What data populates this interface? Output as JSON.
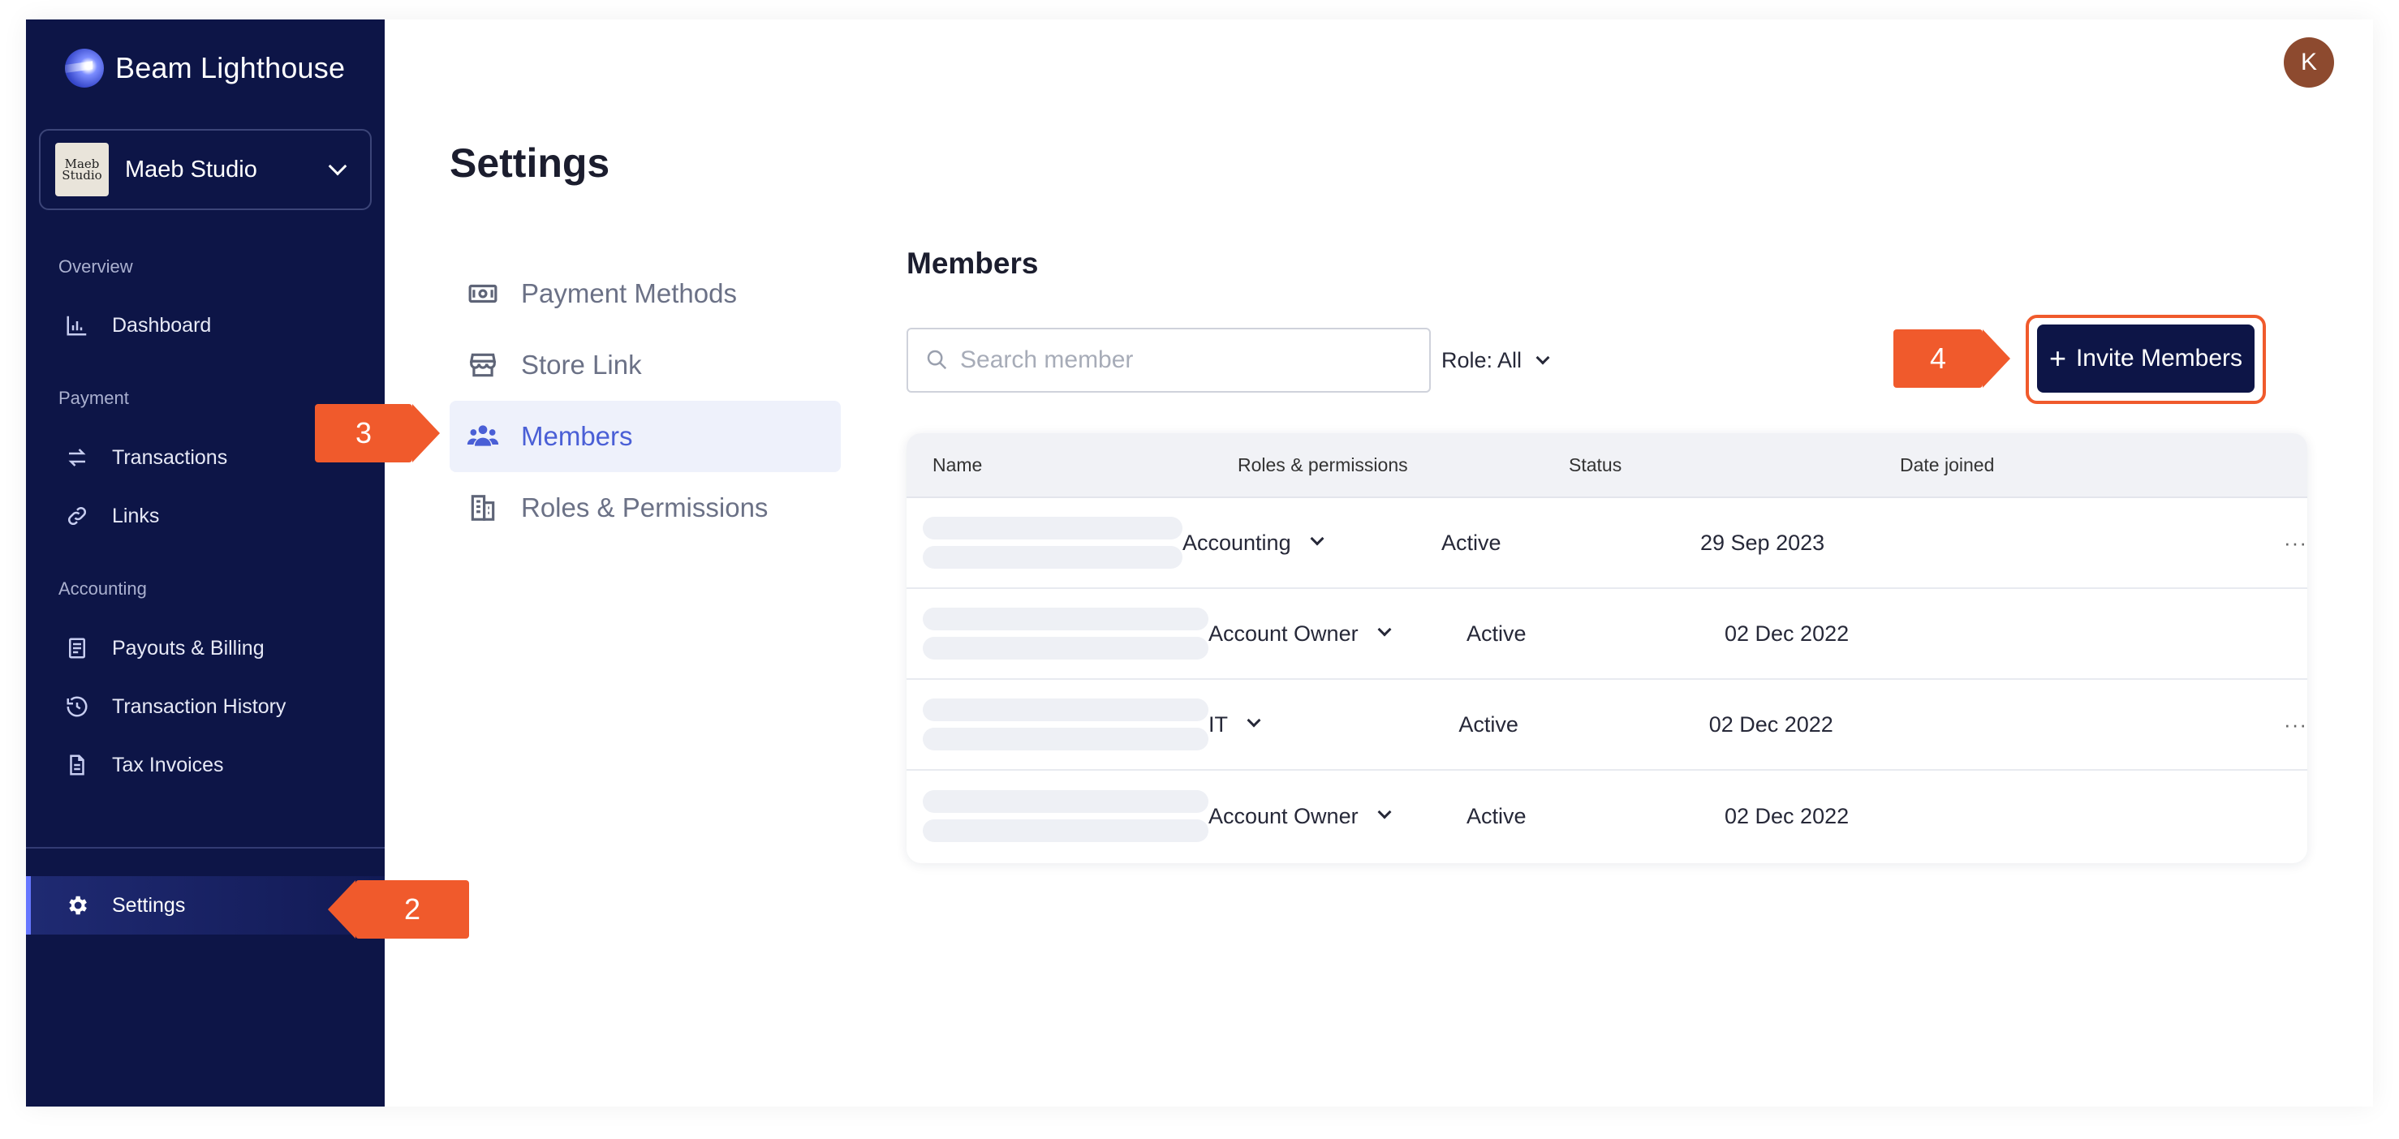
{
  "app": {
    "name": "Beam Lighthouse",
    "user_initial": "K"
  },
  "store": {
    "name": "Maeb Studio",
    "avatar_text": "Maeb Studio"
  },
  "sidebar": {
    "sections": [
      {
        "label": "Overview",
        "items": [
          {
            "label": "Dashboard",
            "icon": "bar-chart-icon"
          }
        ]
      },
      {
        "label": "Payment",
        "items": [
          {
            "label": "Transactions",
            "icon": "arrows-swap-icon"
          },
          {
            "label": "Links",
            "icon": "link-icon"
          }
        ]
      },
      {
        "label": "Accounting",
        "items": [
          {
            "label": "Payouts & Billing",
            "icon": "receipt-icon"
          },
          {
            "label": "Transaction History",
            "icon": "history-icon"
          },
          {
            "label": "Tax Invoices",
            "icon": "document-icon"
          }
        ]
      }
    ],
    "settings": {
      "label": "Settings",
      "icon": "gear-icon"
    }
  },
  "page": {
    "title": "Settings"
  },
  "settings_nav": [
    {
      "label": "Payment Methods",
      "icon": "cash-icon"
    },
    {
      "label": "Store Link",
      "icon": "store-icon"
    },
    {
      "label": "Members",
      "icon": "users-icon",
      "active": true
    },
    {
      "label": "Roles & Permissions",
      "icon": "building-icon"
    }
  ],
  "members": {
    "title": "Members",
    "search_placeholder": "Search member",
    "role_filter": "Role: All",
    "invite_label": "Invite Members",
    "columns": [
      "Name",
      "Roles & permissions",
      "Status",
      "Date joined"
    ],
    "rows": [
      {
        "role": "Accounting",
        "status": "Active",
        "date": "29 Sep 2023",
        "more": "···"
      },
      {
        "role": "Account Owner",
        "status": "Active",
        "date": "02 Dec 2022",
        "more": ""
      },
      {
        "role": "IT",
        "status": "Active",
        "date": "02 Dec 2022",
        "more": "···"
      },
      {
        "role": "Account Owner",
        "status": "Active",
        "date": "02 Dec 2022",
        "more": ""
      }
    ]
  },
  "callouts": {
    "step2": "2",
    "step3": "3",
    "step4": "4"
  },
  "colors": {
    "sidebar": "#0d1547",
    "accent": "#4a5fd6",
    "callout": "#f05a2c"
  }
}
